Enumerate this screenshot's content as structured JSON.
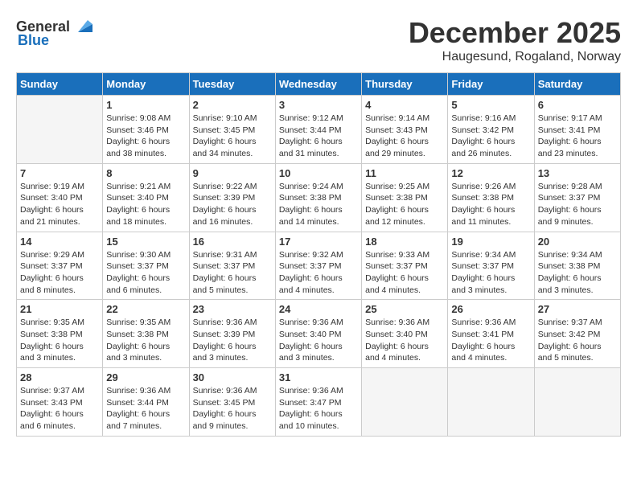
{
  "header": {
    "logo_general": "General",
    "logo_blue": "Blue",
    "month": "December 2025",
    "location": "Haugesund, Rogaland, Norway"
  },
  "weekdays": [
    "Sunday",
    "Monday",
    "Tuesday",
    "Wednesday",
    "Thursday",
    "Friday",
    "Saturday"
  ],
  "weeks": [
    [
      {
        "day": "",
        "empty": true
      },
      {
        "day": "1",
        "sunrise": "Sunrise: 9:08 AM",
        "sunset": "Sunset: 3:46 PM",
        "daylight": "Daylight: 6 hours and 38 minutes."
      },
      {
        "day": "2",
        "sunrise": "Sunrise: 9:10 AM",
        "sunset": "Sunset: 3:45 PM",
        "daylight": "Daylight: 6 hours and 34 minutes."
      },
      {
        "day": "3",
        "sunrise": "Sunrise: 9:12 AM",
        "sunset": "Sunset: 3:44 PM",
        "daylight": "Daylight: 6 hours and 31 minutes."
      },
      {
        "day": "4",
        "sunrise": "Sunrise: 9:14 AM",
        "sunset": "Sunset: 3:43 PM",
        "daylight": "Daylight: 6 hours and 29 minutes."
      },
      {
        "day": "5",
        "sunrise": "Sunrise: 9:16 AM",
        "sunset": "Sunset: 3:42 PM",
        "daylight": "Daylight: 6 hours and 26 minutes."
      },
      {
        "day": "6",
        "sunrise": "Sunrise: 9:17 AM",
        "sunset": "Sunset: 3:41 PM",
        "daylight": "Daylight: 6 hours and 23 minutes."
      }
    ],
    [
      {
        "day": "7",
        "sunrise": "Sunrise: 9:19 AM",
        "sunset": "Sunset: 3:40 PM",
        "daylight": "Daylight: 6 hours and 21 minutes."
      },
      {
        "day": "8",
        "sunrise": "Sunrise: 9:21 AM",
        "sunset": "Sunset: 3:40 PM",
        "daylight": "Daylight: 6 hours and 18 minutes."
      },
      {
        "day": "9",
        "sunrise": "Sunrise: 9:22 AM",
        "sunset": "Sunset: 3:39 PM",
        "daylight": "Daylight: 6 hours and 16 minutes."
      },
      {
        "day": "10",
        "sunrise": "Sunrise: 9:24 AM",
        "sunset": "Sunset: 3:38 PM",
        "daylight": "Daylight: 6 hours and 14 minutes."
      },
      {
        "day": "11",
        "sunrise": "Sunrise: 9:25 AM",
        "sunset": "Sunset: 3:38 PM",
        "daylight": "Daylight: 6 hours and 12 minutes."
      },
      {
        "day": "12",
        "sunrise": "Sunrise: 9:26 AM",
        "sunset": "Sunset: 3:38 PM",
        "daylight": "Daylight: 6 hours and 11 minutes."
      },
      {
        "day": "13",
        "sunrise": "Sunrise: 9:28 AM",
        "sunset": "Sunset: 3:37 PM",
        "daylight": "Daylight: 6 hours and 9 minutes."
      }
    ],
    [
      {
        "day": "14",
        "sunrise": "Sunrise: 9:29 AM",
        "sunset": "Sunset: 3:37 PM",
        "daylight": "Daylight: 6 hours and 8 minutes."
      },
      {
        "day": "15",
        "sunrise": "Sunrise: 9:30 AM",
        "sunset": "Sunset: 3:37 PM",
        "daylight": "Daylight: 6 hours and 6 minutes."
      },
      {
        "day": "16",
        "sunrise": "Sunrise: 9:31 AM",
        "sunset": "Sunset: 3:37 PM",
        "daylight": "Daylight: 6 hours and 5 minutes."
      },
      {
        "day": "17",
        "sunrise": "Sunrise: 9:32 AM",
        "sunset": "Sunset: 3:37 PM",
        "daylight": "Daylight: 6 hours and 4 minutes."
      },
      {
        "day": "18",
        "sunrise": "Sunrise: 9:33 AM",
        "sunset": "Sunset: 3:37 PM",
        "daylight": "Daylight: 6 hours and 4 minutes."
      },
      {
        "day": "19",
        "sunrise": "Sunrise: 9:34 AM",
        "sunset": "Sunset: 3:37 PM",
        "daylight": "Daylight: 6 hours and 3 minutes."
      },
      {
        "day": "20",
        "sunrise": "Sunrise: 9:34 AM",
        "sunset": "Sunset: 3:38 PM",
        "daylight": "Daylight: 6 hours and 3 minutes."
      }
    ],
    [
      {
        "day": "21",
        "sunrise": "Sunrise: 9:35 AM",
        "sunset": "Sunset: 3:38 PM",
        "daylight": "Daylight: 6 hours and 3 minutes."
      },
      {
        "day": "22",
        "sunrise": "Sunrise: 9:35 AM",
        "sunset": "Sunset: 3:38 PM",
        "daylight": "Daylight: 6 hours and 3 minutes."
      },
      {
        "day": "23",
        "sunrise": "Sunrise: 9:36 AM",
        "sunset": "Sunset: 3:39 PM",
        "daylight": "Daylight: 6 hours and 3 minutes."
      },
      {
        "day": "24",
        "sunrise": "Sunrise: 9:36 AM",
        "sunset": "Sunset: 3:40 PM",
        "daylight": "Daylight: 6 hours and 3 minutes."
      },
      {
        "day": "25",
        "sunrise": "Sunrise: 9:36 AM",
        "sunset": "Sunset: 3:40 PM",
        "daylight": "Daylight: 6 hours and 4 minutes."
      },
      {
        "day": "26",
        "sunrise": "Sunrise: 9:36 AM",
        "sunset": "Sunset: 3:41 PM",
        "daylight": "Daylight: 6 hours and 4 minutes."
      },
      {
        "day": "27",
        "sunrise": "Sunrise: 9:37 AM",
        "sunset": "Sunset: 3:42 PM",
        "daylight": "Daylight: 6 hours and 5 minutes."
      }
    ],
    [
      {
        "day": "28",
        "sunrise": "Sunrise: 9:37 AM",
        "sunset": "Sunset: 3:43 PM",
        "daylight": "Daylight: 6 hours and 6 minutes."
      },
      {
        "day": "29",
        "sunrise": "Sunrise: 9:36 AM",
        "sunset": "Sunset: 3:44 PM",
        "daylight": "Daylight: 6 hours and 7 minutes."
      },
      {
        "day": "30",
        "sunrise": "Sunrise: 9:36 AM",
        "sunset": "Sunset: 3:45 PM",
        "daylight": "Daylight: 6 hours and 9 minutes."
      },
      {
        "day": "31",
        "sunrise": "Sunrise: 9:36 AM",
        "sunset": "Sunset: 3:47 PM",
        "daylight": "Daylight: 6 hours and 10 minutes."
      },
      {
        "day": "",
        "empty": true
      },
      {
        "day": "",
        "empty": true
      },
      {
        "day": "",
        "empty": true
      }
    ]
  ]
}
